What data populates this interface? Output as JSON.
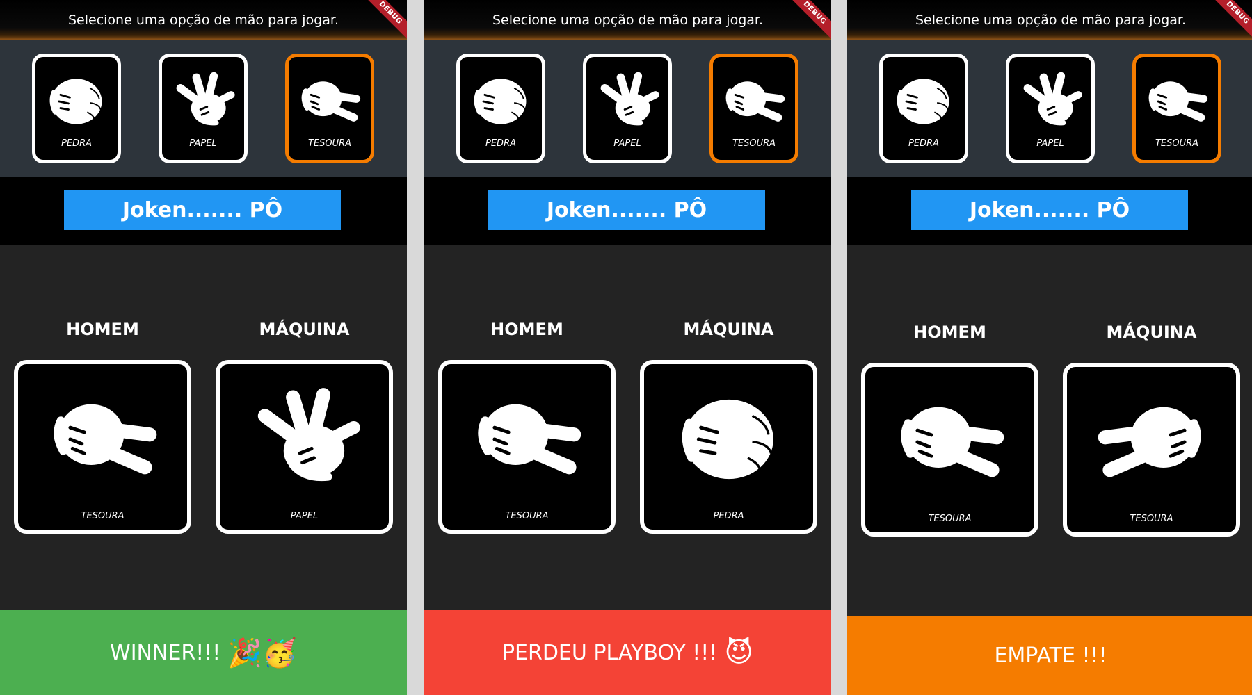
{
  "colors": {
    "accent_selected": "#f57c00",
    "button": "#2196f3",
    "winner": "#4caf50",
    "lose": "#f44336",
    "draw": "#f57c00"
  },
  "screens": [
    {
      "header": {
        "title": "Selecione uma opção de mão para jogar.",
        "debug": "DEBUG"
      },
      "options": [
        {
          "label": "PEDRA",
          "icon": "rock-hand-icon",
          "selected": false
        },
        {
          "label": "PAPEL",
          "icon": "paper-hand-icon",
          "selected": false
        },
        {
          "label": "TESOURA",
          "icon": "scissors-hand-icon",
          "selected": true
        }
      ],
      "play_button": "Joken.......   PÔ",
      "human": {
        "title": "HOMEM",
        "choice": "TESOURA"
      },
      "machine": {
        "title": "MÁQUINA",
        "choice": "PAPEL"
      },
      "result": {
        "text": "WINNER!!!",
        "emoji": "🎉🥳",
        "status": "win"
      }
    },
    {
      "header": {
        "title": "Selecione uma opção de mão para jogar.",
        "debug": "DEBUG"
      },
      "options": [
        {
          "label": "PEDRA",
          "icon": "rock-hand-icon",
          "selected": false
        },
        {
          "label": "PAPEL",
          "icon": "paper-hand-icon",
          "selected": false
        },
        {
          "label": "TESOURA",
          "icon": "scissors-hand-icon",
          "selected": true
        }
      ],
      "play_button": "Joken.......   PÔ",
      "human": {
        "title": "HOMEM",
        "choice": "TESOURA"
      },
      "machine": {
        "title": "MÁQUINA",
        "choice": "PEDRA"
      },
      "result": {
        "text": "PERDEU PLAYBOY !!!",
        "emoji": "😈",
        "status": "lose"
      }
    },
    {
      "header": {
        "title": "Selecione uma opção de mão para jogar.",
        "debug": "DEBUG"
      },
      "options": [
        {
          "label": "PEDRA",
          "icon": "rock-hand-icon",
          "selected": false
        },
        {
          "label": "PAPEL",
          "icon": "paper-hand-icon",
          "selected": false
        },
        {
          "label": "TESOURA",
          "icon": "scissors-hand-icon",
          "selected": true
        }
      ],
      "play_button": "Joken.......   PÔ",
      "human": {
        "title": "HOMEM",
        "choice": "TESOURA"
      },
      "machine": {
        "title": "MÁQUINA",
        "choice": "TESOURA"
      },
      "result": {
        "text": "EMPATE !!!",
        "emoji": "",
        "status": "draw"
      }
    }
  ]
}
